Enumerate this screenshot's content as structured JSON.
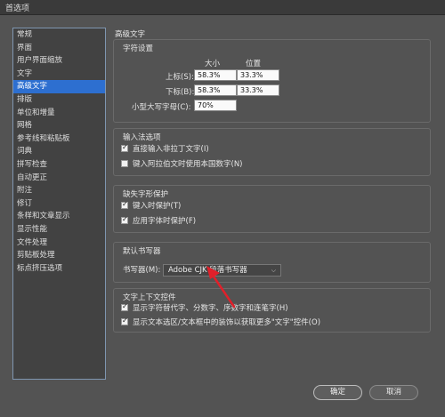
{
  "window": {
    "title": "首选项"
  },
  "sidebar": {
    "items": [
      {
        "label": "常规"
      },
      {
        "label": "界面"
      },
      {
        "label": "用户界面缩放"
      },
      {
        "label": "文字"
      },
      {
        "label": "高级文字",
        "selected": true
      },
      {
        "label": "排版"
      },
      {
        "label": "单位和增量"
      },
      {
        "label": "网格"
      },
      {
        "label": "参考线和粘贴板"
      },
      {
        "label": "词典"
      },
      {
        "label": "拼写检查"
      },
      {
        "label": "自动更正"
      },
      {
        "label": "附注"
      },
      {
        "label": "修订"
      },
      {
        "label": "条样和文章显示"
      },
      {
        "label": "显示性能"
      },
      {
        "label": "文件处理"
      },
      {
        "label": "剪贴板处理"
      },
      {
        "label": "标点挤压选项"
      }
    ]
  },
  "main": {
    "title": "高级文字",
    "char_settings": {
      "title": "字符设置",
      "col_size": "大小",
      "col_position": "位置",
      "superscript_label": "上标(S):",
      "superscript_size": "58.3%",
      "superscript_position": "33.3%",
      "subscript_label": "下标(B):",
      "subscript_size": "58.3%",
      "subscript_position": "33.3%",
      "smallcaps_label": "小型大写字母(C):",
      "smallcaps_value": "70%"
    },
    "input_options": {
      "title": "输入法选项",
      "inline_input": {
        "label": "直接输入非拉丁文字(I)",
        "checked": true
      },
      "arabic_digits": {
        "label": "键入阿拉伯文时使用本国数字(N)",
        "checked": false
      }
    },
    "missing_glyph": {
      "title": "缺失字形保护",
      "protect_typing": {
        "label": "键入时保护(T)",
        "checked": true
      },
      "protect_font": {
        "label": "应用字体时保护(F)",
        "checked": true
      }
    },
    "composer": {
      "title": "默认书写器",
      "label": "书写器(M):",
      "value": "Adobe CJK 段落书写器"
    },
    "context_controls": {
      "title": "文字上下文控件",
      "show_alternates": {
        "label": "显示字符替代字、分数字、序数字和连笔字(H)",
        "checked": true
      },
      "show_more": {
        "label": "显示文本选区/文本框中的装饰以获取更多\"文字\"控件(O)",
        "checked": true
      }
    }
  },
  "buttons": {
    "ok": "确定",
    "cancel": "取消"
  },
  "colors": {
    "selection": "#2d6fd0",
    "annotation_arrow": "#e0202a"
  }
}
